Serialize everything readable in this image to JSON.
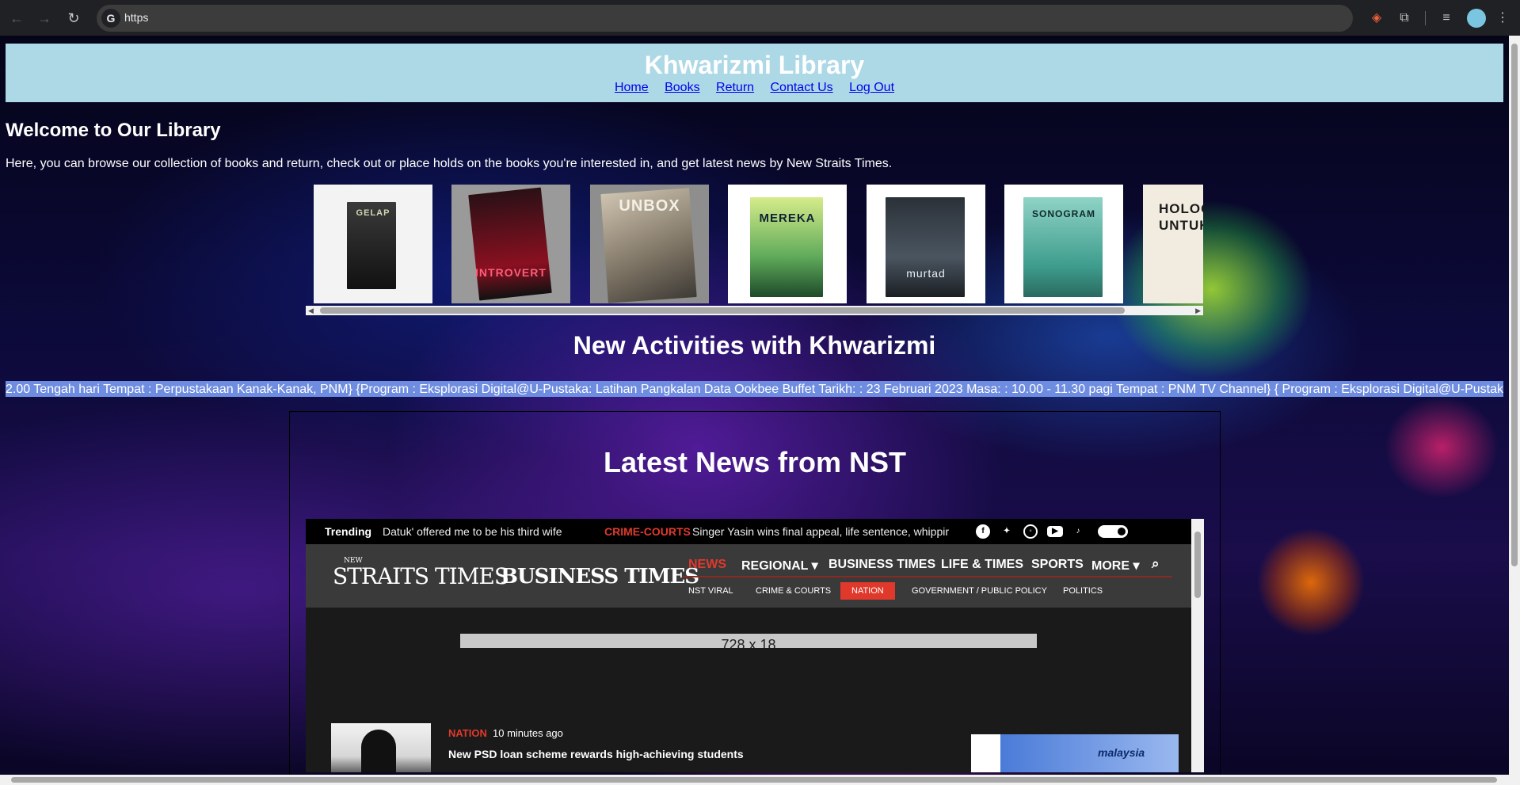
{
  "browser": {
    "url": "https",
    "google_badge": "G"
  },
  "site": {
    "title": "Khwarizmi Library",
    "nav": [
      "Home",
      "Books",
      "Return",
      "Contact Us",
      "Log Out"
    ]
  },
  "welcome": {
    "heading": "Welcome to Our Library",
    "intro": "Here, you can browse our collection of books and return, check out or place holds on the books you're interested in, and get latest news by New Straits Times."
  },
  "books": [
    {
      "title": "GELAP"
    },
    {
      "title": "INTROVERT"
    },
    {
      "title": "UNBOX"
    },
    {
      "title": "MEREKA"
    },
    {
      "title": "murtad"
    },
    {
      "title": "SONOGRAM"
    },
    {
      "title": "HOLOGRAM UNTUK RAJA"
    }
  ],
  "activities": {
    "heading": "New Activities with Khwarizmi",
    "ticker": "2.00 Tengah hari Tempat : Perpustakaan Kanak-Kanak, PNM} {Program : Eksplorasi Digital@U-Pustaka: Latihan Pangkalan Data Ookbee Buffet Tarikh: : 23 Februari 2023 Masa: : 10.00 - 11.30 pagi Tempat : PNM TV Channel} { Program : Eksplorasi Digital@U-Pustaka"
  },
  "news": {
    "heading": "Latest News from NST",
    "trending_label": "Trending",
    "trending_story": "Datuk' offered me to be his third wife",
    "crime_tag": "CRIME-COURTS",
    "crime_story": "Singer Yasin wins final appeal, life sentence, whippir",
    "logo_small": "NEW",
    "logo_nst": "STRAITS TIMES",
    "logo_bt": "BUSINESS TIMES",
    "main_nav": [
      "NEWS",
      "REGIONAL ▾",
      "BUSINESS TIMES",
      "LIFE & TIMES",
      "SPORTS",
      "MORE ▾"
    ],
    "sub_nav": [
      "NST VIRAL",
      "CRIME & COURTS",
      "NATION",
      "GOVERNMENT / PUBLIC POLICY",
      "POLITICS"
    ],
    "ad_size": "728 x 18",
    "article_category": "NATION",
    "article_time": "10 minutes ago",
    "article_title": "New PSD loan scheme rewards high-achieving students",
    "side_ad_brand": "malaysia"
  },
  "colors": {
    "header_bg": "#add8e6",
    "link": "#0000ee",
    "ticker_bg": "#6f8de0",
    "nst_accent": "#e0392b"
  }
}
